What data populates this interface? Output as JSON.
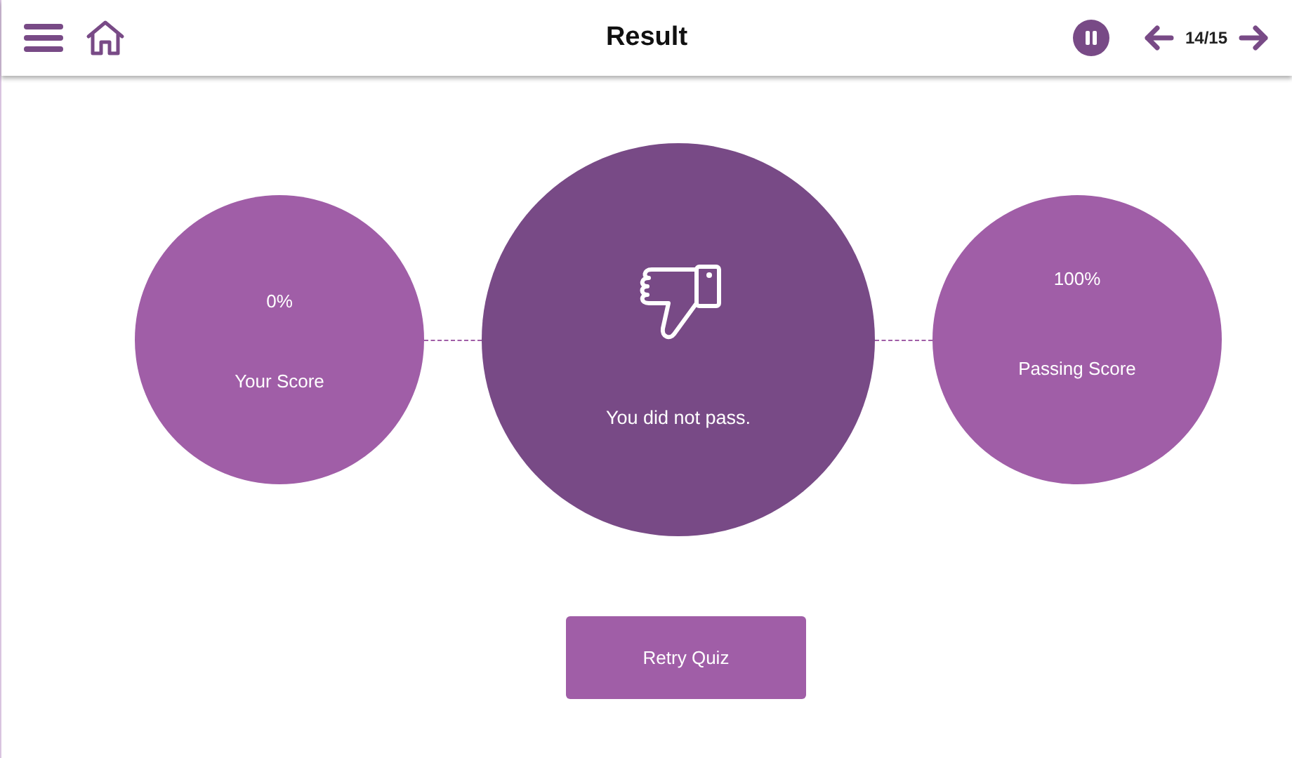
{
  "header": {
    "title": "Result",
    "counter": "14/15"
  },
  "your_score": {
    "value": "0%",
    "label": "Your Score"
  },
  "result": {
    "passed": false,
    "message": "You did not pass."
  },
  "passing_score": {
    "value": "100%",
    "label": "Passing Score"
  },
  "retry_button": "Retry Quiz"
}
